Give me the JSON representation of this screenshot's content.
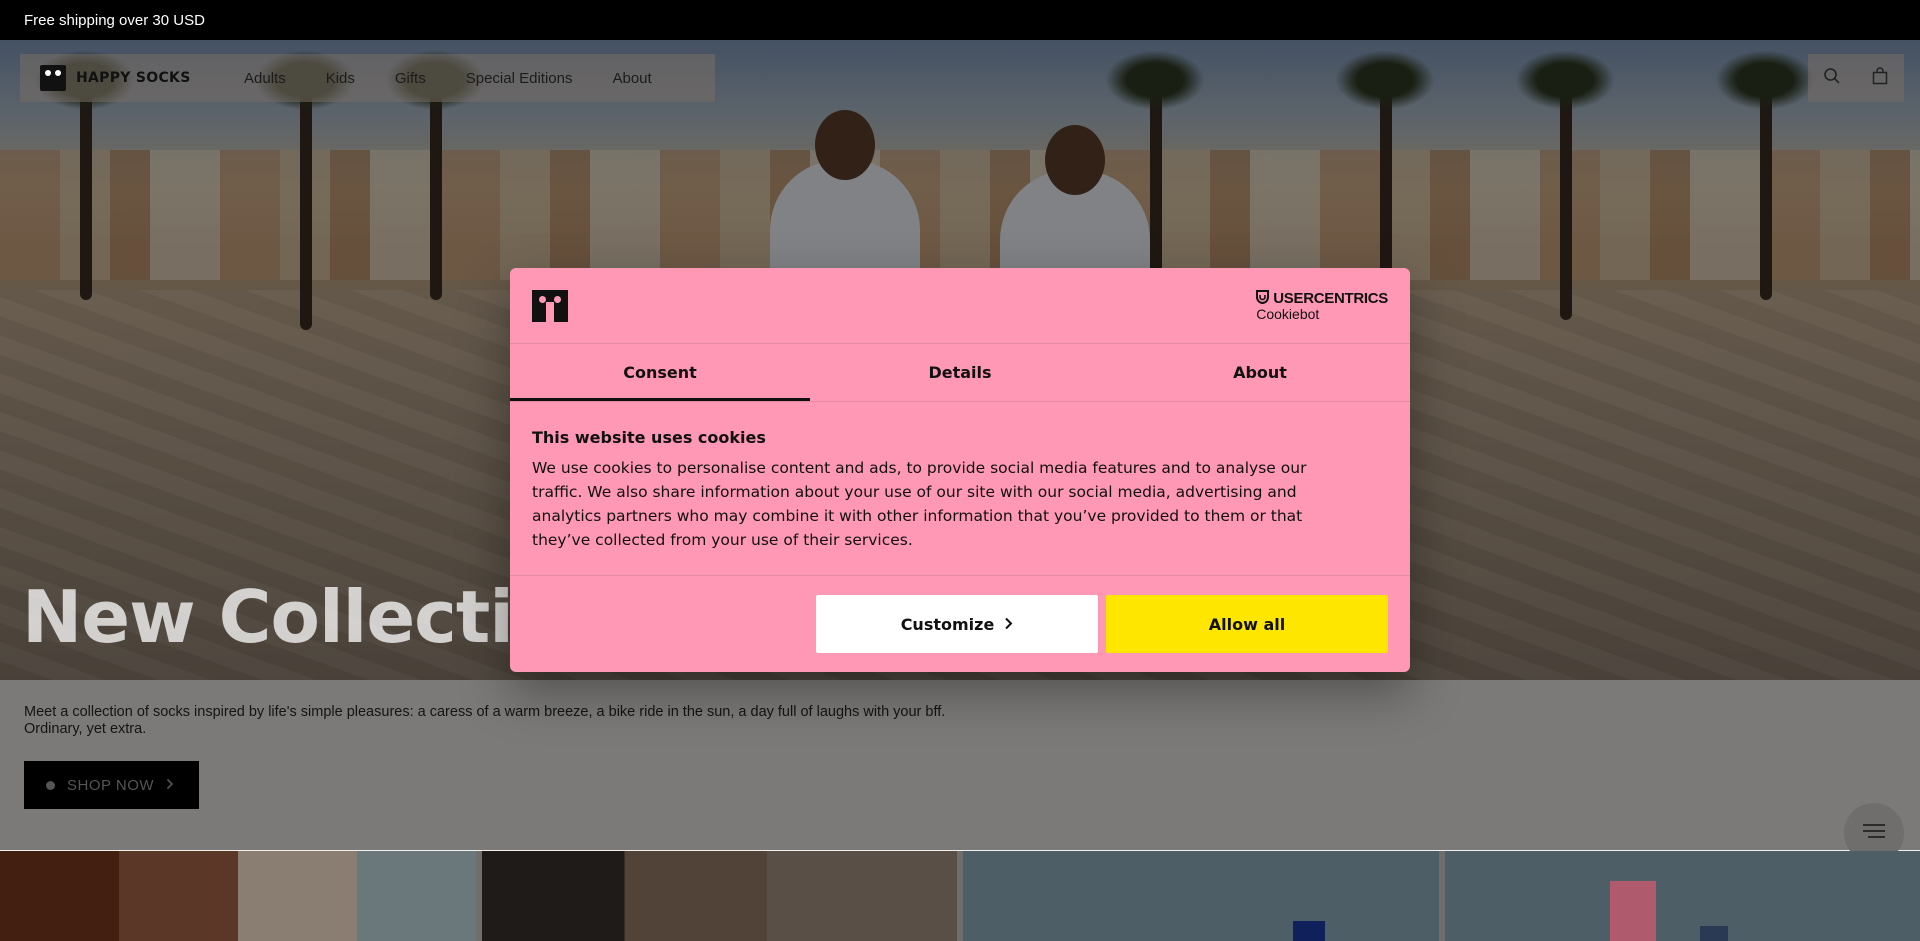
{
  "announcement": "Free shipping over 30 USD",
  "header": {
    "logo_text": "HAPPY SOCKS",
    "nav": [
      {
        "label": "Adults"
      },
      {
        "label": "Kids"
      },
      {
        "label": "Gifts"
      },
      {
        "label": "Special Editions"
      },
      {
        "label": "About"
      }
    ],
    "icons": [
      "search-icon",
      "bag-icon"
    ]
  },
  "hero": {
    "title": "New Collection"
  },
  "intro": {
    "text": "Meet a collection of socks inspired by life's simple pleasures: a caress of a warm breeze, a bike ride in the sun, a day full of laughs with your bff. Ordinary, yet extra.",
    "cta": "SHOP NOW"
  },
  "cookie_dialog": {
    "brand_top": "USERCENTRICS",
    "brand_bottom": "Cookiebot",
    "tabs": [
      {
        "label": "Consent",
        "active": true
      },
      {
        "label": "Details",
        "active": false
      },
      {
        "label": "About",
        "active": false
      }
    ],
    "heading": "This website uses cookies",
    "body": "We use cookies to personalise content and ads, to provide social media features and to analyse our traffic. We also share information about your use of our site with our social media, advertising and analytics partners who may combine it with other information that you’ve provided to them or that they’ve collected from your use of their services.",
    "customize_label": "Customize",
    "allow_all_label": "Allow all",
    "colors": {
      "background": "#ff98b4",
      "allow_button": "#ffe600",
      "customize_button": "#ffffff"
    }
  }
}
